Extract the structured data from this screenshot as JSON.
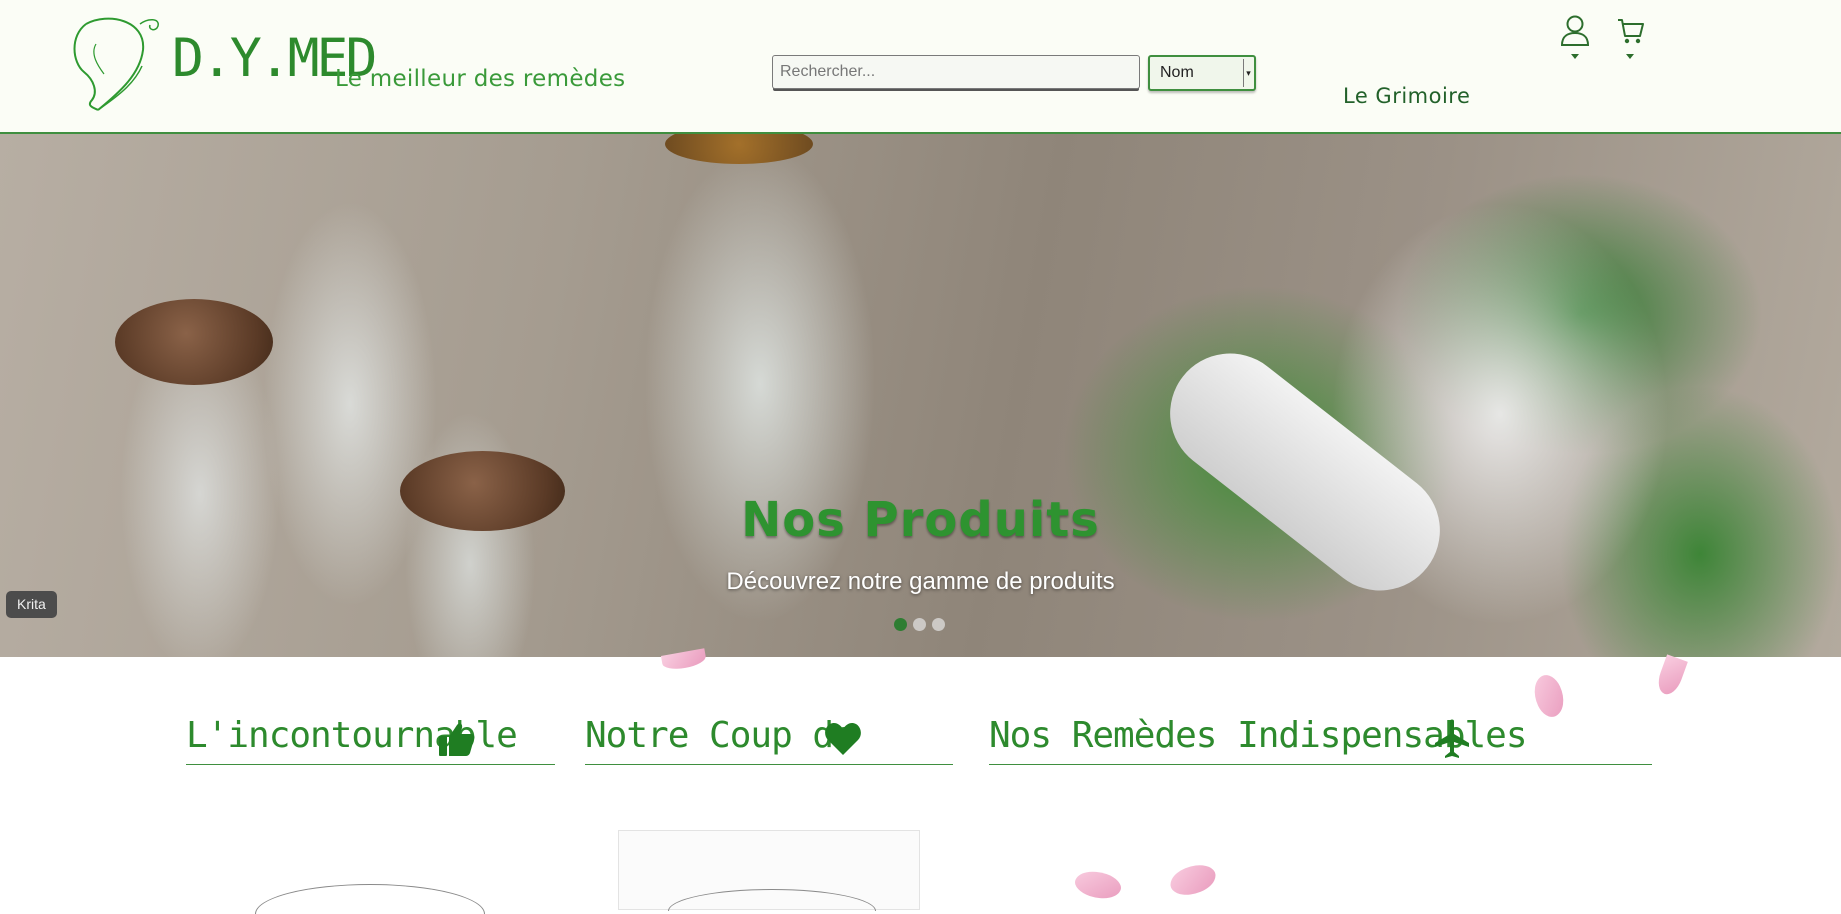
{
  "header": {
    "brand": "D.Y.MED",
    "tagline": "Le meilleur des remèdes",
    "search_placeholder": "Rechercher...",
    "sort_selected": "Nom",
    "grimoire_link": "Le Grimoire"
  },
  "hero": {
    "title": "Nos Produits",
    "subtitle": "Découvrez notre gamme de produits",
    "slide_count": 3,
    "active_slide": 1,
    "overlay_badge": "Krita"
  },
  "sections": [
    {
      "title": "L'incontournable",
      "icon": "thumbs-up-icon"
    },
    {
      "title": "Notre Coup de",
      "icon": "heart-icon"
    },
    {
      "title": "Nos Remèdes Indispensables",
      "icon": "airplane-icon"
    }
  ],
  "colors": {
    "brand_green": "#2d8a2d",
    "header_bg": "#fbfdf6",
    "active_dot": "#2e7d32",
    "petal_pink": "#f3b3cf"
  }
}
